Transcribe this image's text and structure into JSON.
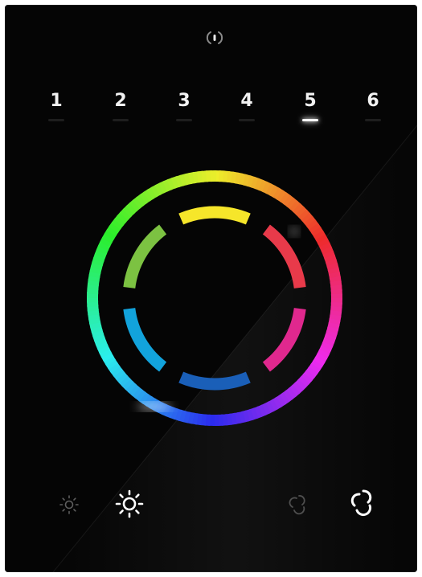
{
  "zones": [
    {
      "label": "1",
      "active": false
    },
    {
      "label": "2",
      "active": false
    },
    {
      "label": "3",
      "active": false
    },
    {
      "label": "4",
      "active": false
    },
    {
      "label": "5",
      "active": true
    },
    {
      "label": "6",
      "active": false
    }
  ],
  "icons": {
    "power": "power-icon",
    "brightness_down": "sun-small-icon",
    "brightness_up": "sun-large-icon",
    "mode_dim": "cycle-icon",
    "mode_bright": "cycle-icon"
  },
  "segments": [
    {
      "name": "yellow",
      "color": "#f6e62a"
    },
    {
      "name": "red",
      "color": "#e83a4a"
    },
    {
      "name": "magenta",
      "color": "#e0288e"
    },
    {
      "name": "blue",
      "color": "#1a5fb8"
    },
    {
      "name": "cyan",
      "color": "#12a3dc"
    },
    {
      "name": "green",
      "color": "#7cc242"
    }
  ],
  "colors": {
    "panel": "#050505",
    "text": "#f2f2f2",
    "indicator_off": "#1e1e1e",
    "indicator_on": "#ffffff"
  }
}
